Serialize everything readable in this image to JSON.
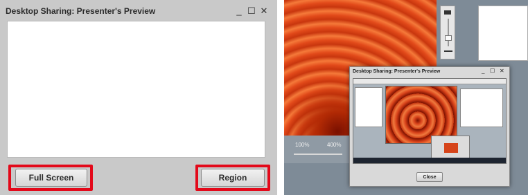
{
  "left_window": {
    "title": "Desktop Sharing: Presenter's Preview",
    "controls": {
      "minimize": "_",
      "maximize": "☐",
      "close": "✕"
    },
    "buttons": {
      "full_screen": "Full Screen",
      "region": "Region"
    }
  },
  "right_preview": {
    "zoom_min_label": "100%",
    "zoom_max_label": "400%",
    "nested_window": {
      "title": "Desktop Sharing: Presenter's Preview",
      "controls": {
        "minimize": "_",
        "maximize": "☐",
        "close": "✕"
      },
      "close_button": "Close"
    }
  },
  "colors": {
    "highlight": "#e3091a",
    "window_bg": "#c9c9c9",
    "flower_orange": "#e45020"
  }
}
